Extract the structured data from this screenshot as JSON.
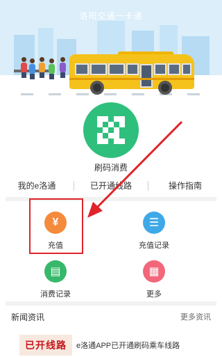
{
  "banner": {
    "title": "洛阳交通一卡通"
  },
  "qr": {
    "label": "刷码消费",
    "icon": "qr-code-icon",
    "color": "#2fbf7c"
  },
  "links": [
    {
      "label": "我的e洛通"
    },
    {
      "label": "已开通线路"
    },
    {
      "label": "操作指南"
    }
  ],
  "functions": [
    {
      "label": "充值",
      "icon": "yen-icon",
      "glyph": "¥",
      "color": "#f48a3c"
    },
    {
      "label": "充值记录",
      "icon": "document-icon",
      "glyph": "☰",
      "color": "#3fa9e8"
    },
    {
      "label": "消费记录",
      "icon": "receipt-icon",
      "glyph": "▤",
      "color": "#37b86a"
    },
    {
      "label": "更多",
      "icon": "grid-icon",
      "glyph": "▦",
      "color": "#f2677a"
    }
  ],
  "news": {
    "title": "新闻资讯",
    "more": "更多资讯",
    "items": [
      {
        "thumb_text": "已开线路",
        "text": "e洛通APP已开通刷码乘车线路"
      }
    ]
  },
  "highlight": {
    "color": "#e0242a"
  }
}
